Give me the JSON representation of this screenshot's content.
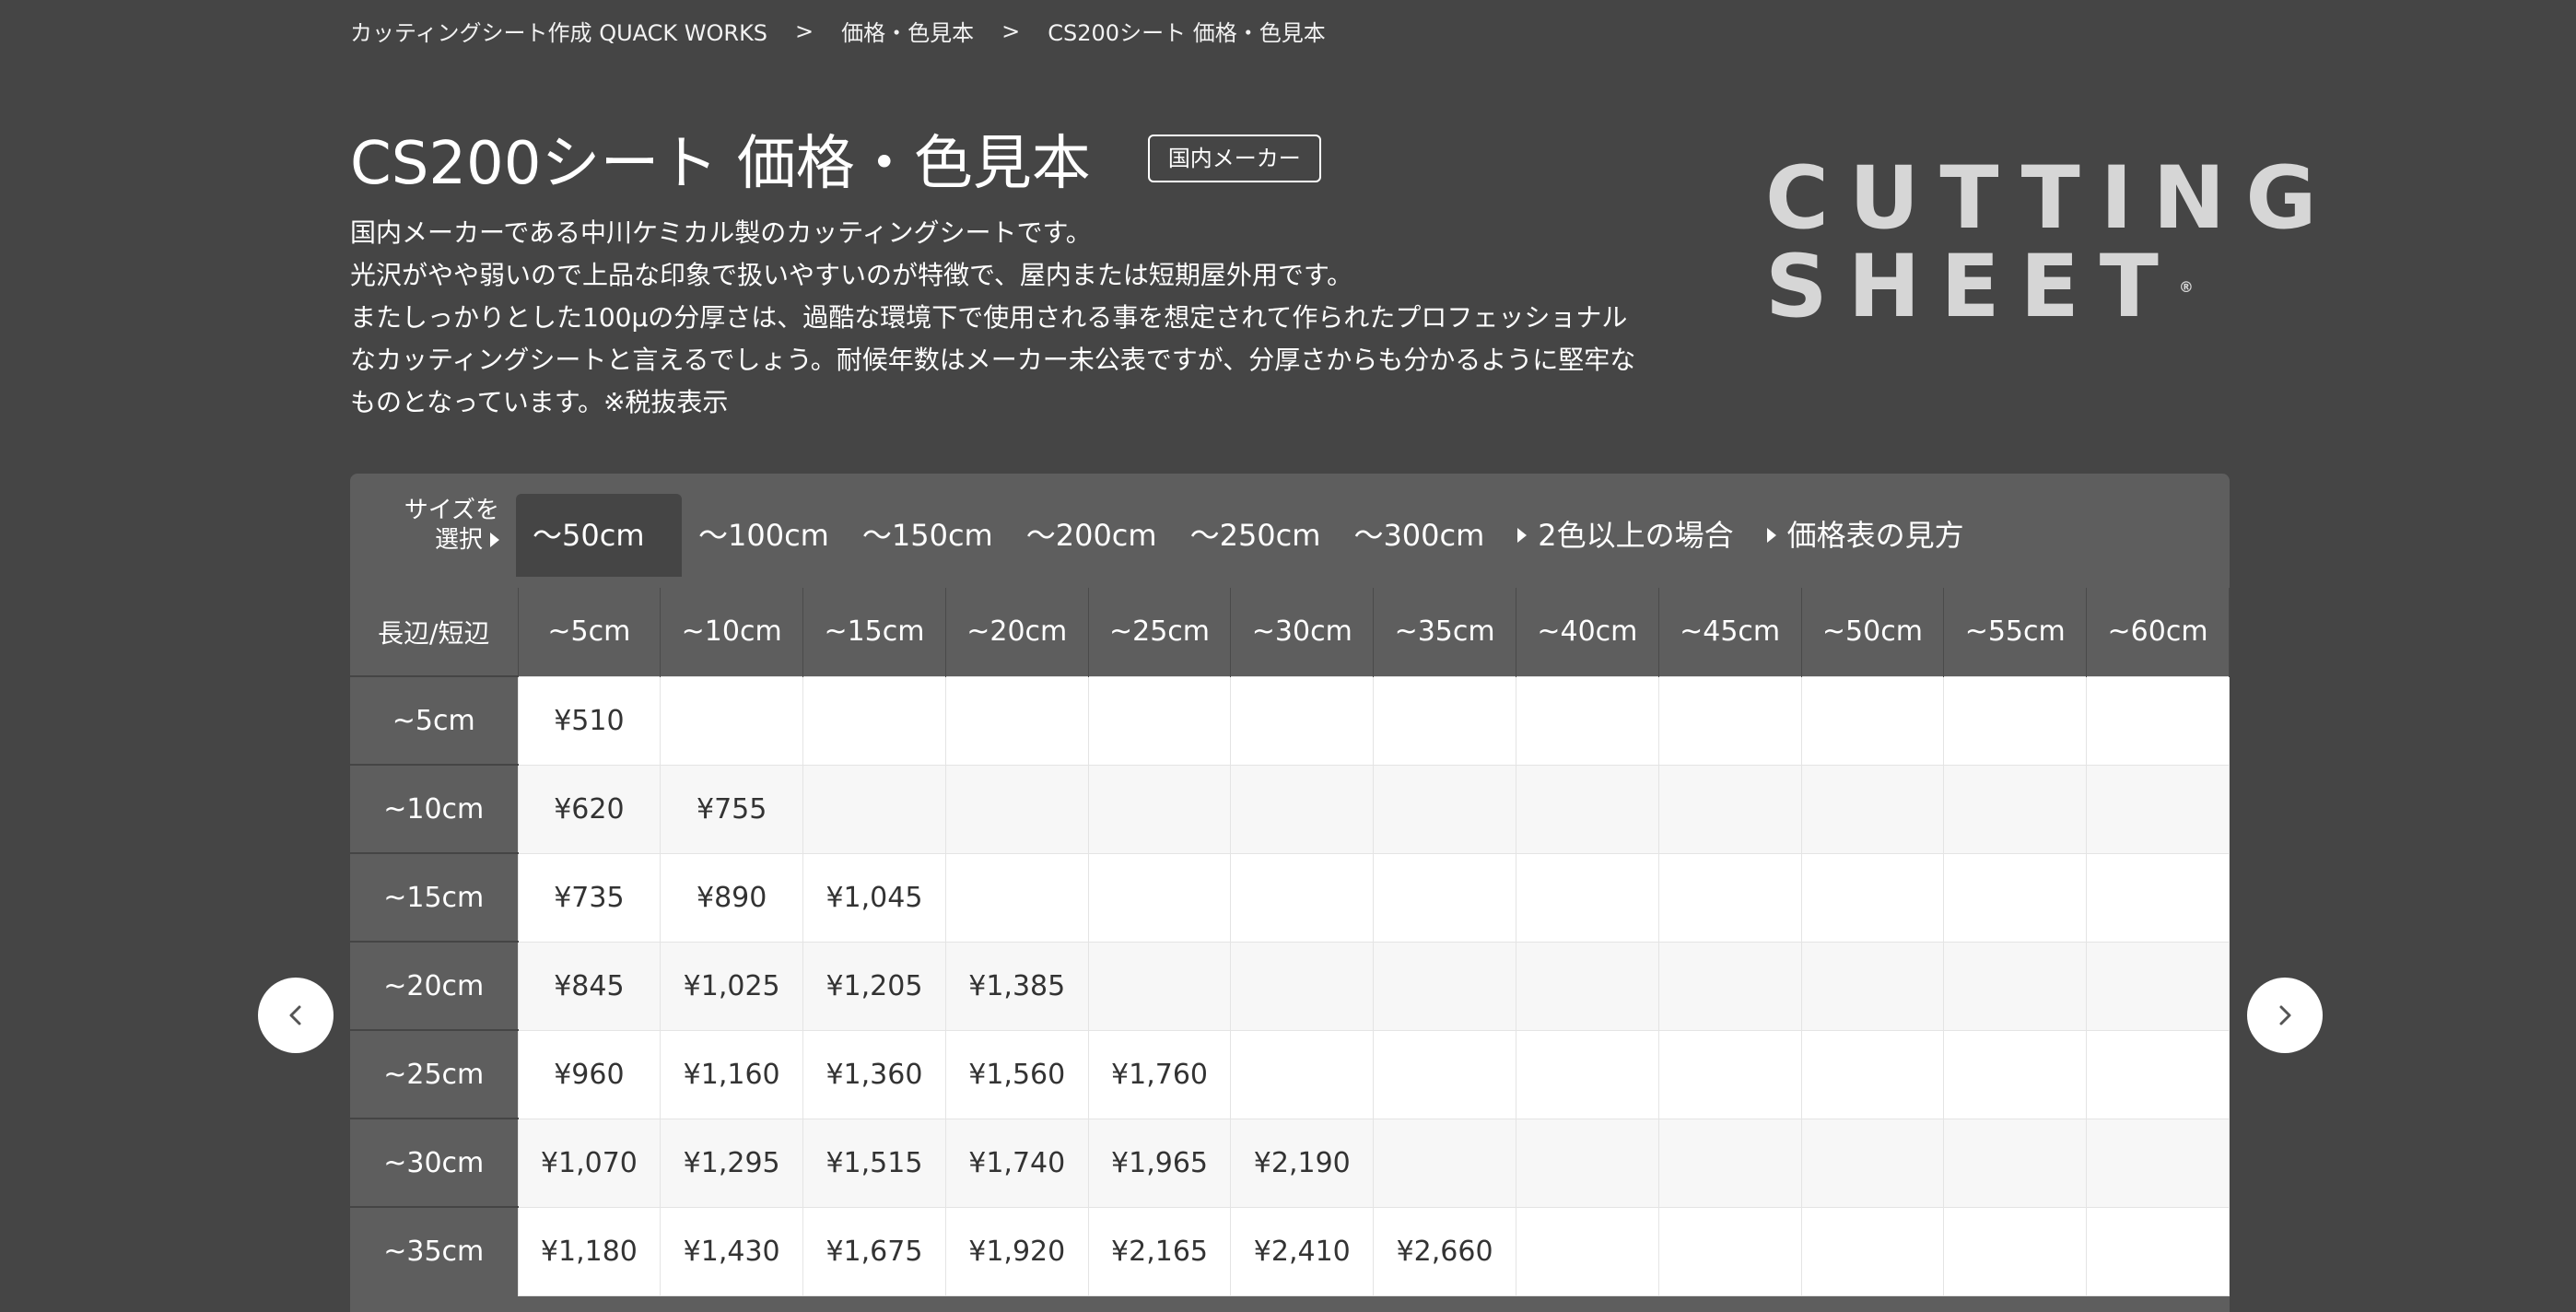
{
  "breadcrumb": {
    "items": [
      "カッティングシート作成 QUACK WORKS",
      "価格・色見本",
      "CS200シート 価格・色見本"
    ],
    "separator": ">"
  },
  "header": {
    "title": "CS200シート 価格・色見本",
    "badge": "国内メーカー"
  },
  "description": {
    "lines": [
      "国内メーカーである中川ケミカル製のカッティングシートです。",
      "光沢がやや弱いので上品な印象で扱いやすいのが特徴で、屋内または短期屋外用です。",
      "またしっかりとした100μの分厚さは、過酷な環境下で使用される事を想定されて作られたプロフェッショナル",
      "なカッティングシートと言えるでしょう。耐候年数はメーカー未公表ですが、分厚さからも分かるように堅牢な",
      "ものとなっています。※税抜表示"
    ]
  },
  "logo": {
    "line1": "CUTTING",
    "line2": "SHEET",
    "mark": "®"
  },
  "size_tabs": {
    "prompt_line1": "サイズを",
    "prompt_line2": "選択",
    "tabs": [
      "〜50cm",
      "〜100cm",
      "〜150cm",
      "〜200cm",
      "〜250cm",
      "〜300cm"
    ],
    "active_index": 0,
    "links": [
      "2色以上の場合",
      "価格表の見方"
    ]
  },
  "price_table": {
    "corner": "長辺/短辺",
    "columns": [
      "~5cm",
      "~10cm",
      "~15cm",
      "~20cm",
      "~25cm",
      "~30cm",
      "~35cm",
      "~40cm",
      "~45cm",
      "~50cm",
      "~55cm",
      "~60cm"
    ],
    "rows": [
      {
        "label": "~5cm",
        "cells": [
          "¥510",
          "",
          "",
          "",
          "",
          "",
          "",
          "",
          "",
          "",
          "",
          ""
        ]
      },
      {
        "label": "~10cm",
        "cells": [
          "¥620",
          "¥755",
          "",
          "",
          "",
          "",
          "",
          "",
          "",
          "",
          "",
          ""
        ]
      },
      {
        "label": "~15cm",
        "cells": [
          "¥735",
          "¥890",
          "¥1,045",
          "",
          "",
          "",
          "",
          "",
          "",
          "",
          "",
          ""
        ]
      },
      {
        "label": "~20cm",
        "cells": [
          "¥845",
          "¥1,025",
          "¥1,205",
          "¥1,385",
          "",
          "",
          "",
          "",
          "",
          "",
          "",
          ""
        ]
      },
      {
        "label": "~25cm",
        "cells": [
          "¥960",
          "¥1,160",
          "¥1,360",
          "¥1,560",
          "¥1,760",
          "",
          "",
          "",
          "",
          "",
          "",
          ""
        ]
      },
      {
        "label": "~30cm",
        "cells": [
          "¥1,070",
          "¥1,295",
          "¥1,515",
          "¥1,740",
          "¥1,965",
          "¥2,190",
          "",
          "",
          "",
          "",
          "",
          ""
        ]
      },
      {
        "label": "~35cm",
        "cells": [
          "¥1,180",
          "¥1,430",
          "¥1,675",
          "¥1,920",
          "¥2,165",
          "¥2,410",
          "¥2,660",
          "",
          "",
          "",
          "",
          ""
        ]
      }
    ]
  },
  "nav": {
    "prev_icon": "chevron-left-icon",
    "next_icon": "chevron-right-icon"
  },
  "colors": {
    "background": "#454545",
    "panel": "#5e5e5e",
    "cell_text": "#333333"
  }
}
